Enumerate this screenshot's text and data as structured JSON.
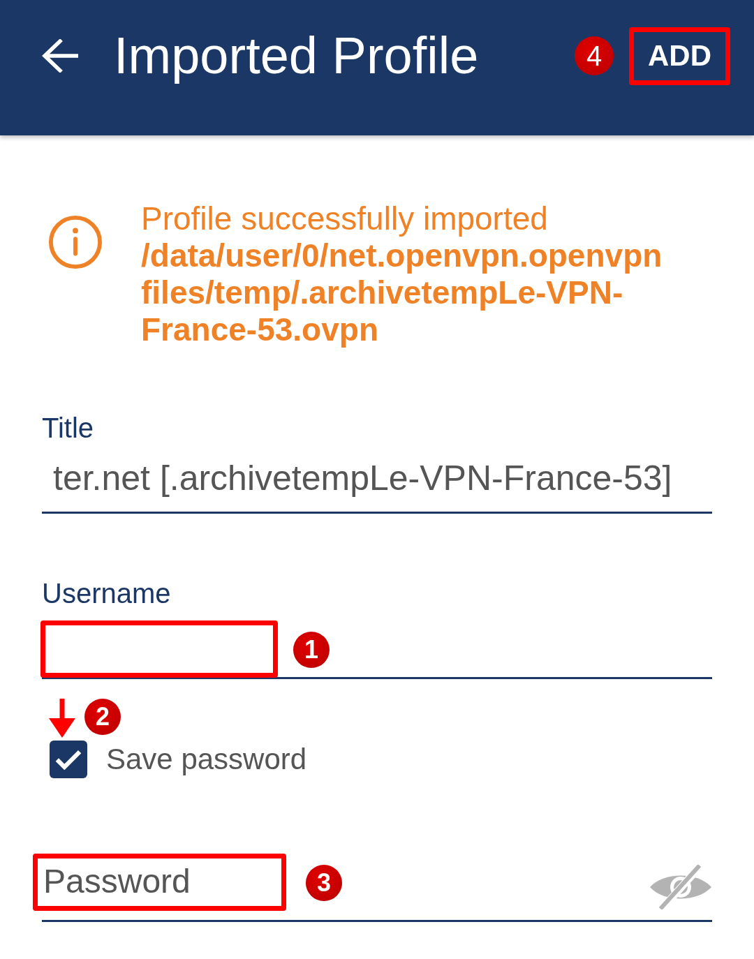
{
  "app_bar": {
    "title": "Imported Profile",
    "action": {
      "label": "ADD",
      "highlighted": true,
      "annotation": "4"
    }
  },
  "notice": {
    "message": "Profile successfully imported",
    "path_lines": [
      "/data/user/0/net.openvpn.openvpn",
      "files/temp/.archivetempLe-VPN-",
      "France-53.ovpn"
    ]
  },
  "fields": [
    {
      "kind": "text",
      "label": "Title",
      "value": "ter.net [.archivetempLe-VPN-France-53]"
    },
    {
      "kind": "text",
      "label": "Username",
      "highlighted": true,
      "annotation": "1"
    },
    {
      "kind": "checkbox",
      "label": "Save password",
      "checked": true,
      "annotation": "2",
      "pointer_arrow": true
    },
    {
      "kind": "password",
      "placeholder": "Password",
      "highlighted": true,
      "annotation": "3"
    }
  ]
}
